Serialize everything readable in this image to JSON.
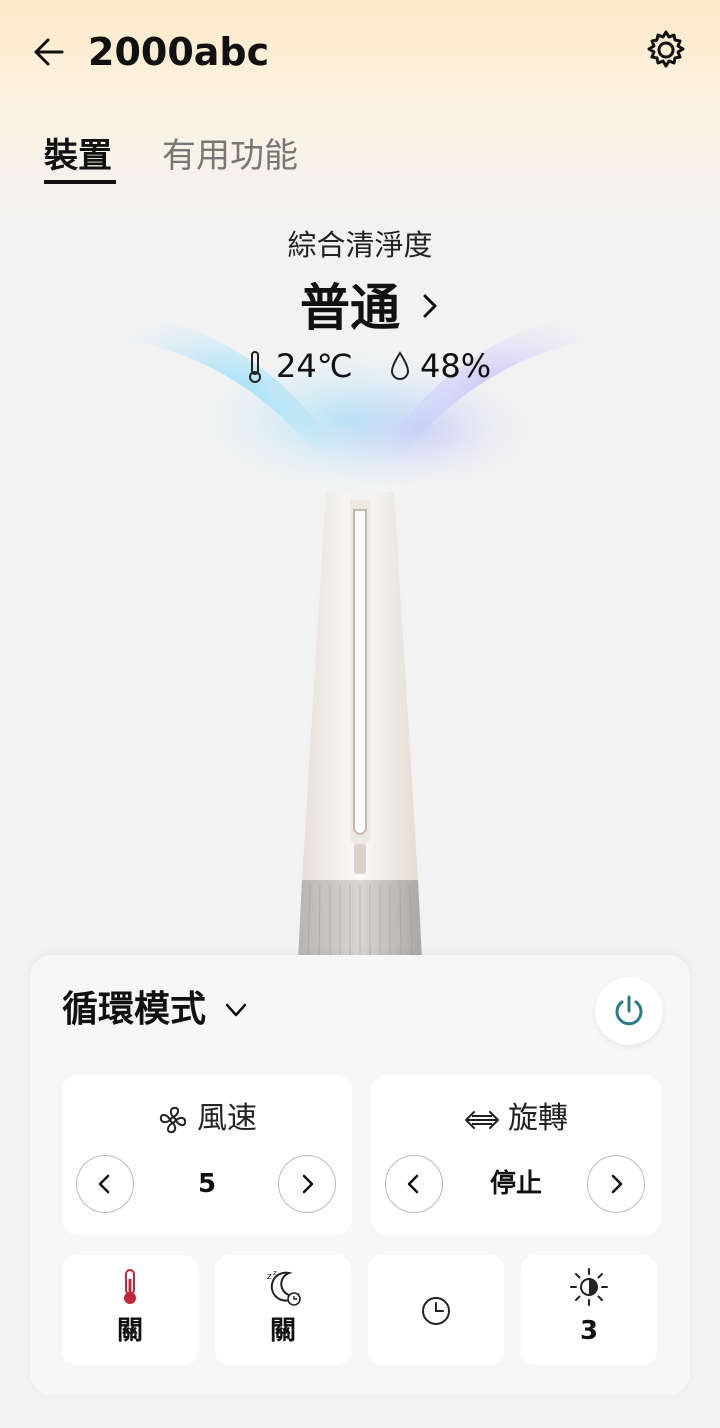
{
  "header": {
    "title": "2000abc"
  },
  "tabs": [
    {
      "label": "裝置",
      "active": true
    },
    {
      "label": "有用功能",
      "active": false
    }
  ],
  "status": {
    "label": "綜合清淨度",
    "value": "普通",
    "temperature": "24℃",
    "humidity": "48%"
  },
  "panel": {
    "mode": "循環模式",
    "wind_speed": {
      "label": "風速",
      "value": "5"
    },
    "rotation": {
      "label": "旋轉",
      "value": "停止"
    },
    "quick": [
      {
        "icon": "thermometer-icon",
        "value": "關"
      },
      {
        "icon": "sleep-moon-icon",
        "value": "關"
      },
      {
        "icon": "timer-icon",
        "value": ""
      },
      {
        "icon": "brightness-icon",
        "value": "3"
      }
    ]
  },
  "colors": {
    "accent": "#2a7a87",
    "heat": "#c0283a"
  }
}
